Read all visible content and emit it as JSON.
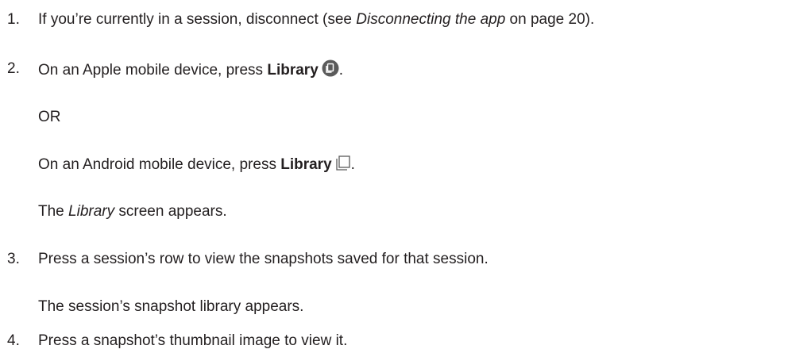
{
  "steps": [
    {
      "number": "1.",
      "text_before": "If you’re currently in a session, disconnect (see ",
      "text_italic": "Disconnecting the app",
      "text_after": " on page 20)."
    },
    {
      "number": "2.",
      "apple_before": "On an Apple mobile device, press ",
      "apple_bold": "Library",
      "apple_after": ".",
      "apple_icon": "library-icon-apple",
      "or": "OR",
      "android_before": "On an Android mobile device, press ",
      "android_bold": "Library",
      "android_after": ".",
      "android_icon": "library-icon-android",
      "result_before": "The ",
      "result_italic": "Library",
      "result_after": " screen appears."
    },
    {
      "number": "3.",
      "text": "Press a session’s row to view the snapshots saved for that session.",
      "result": "The session’s snapshot library appears."
    },
    {
      "number": "4.",
      "text": "Press a snapshot’s thumbnail image to view it."
    }
  ]
}
